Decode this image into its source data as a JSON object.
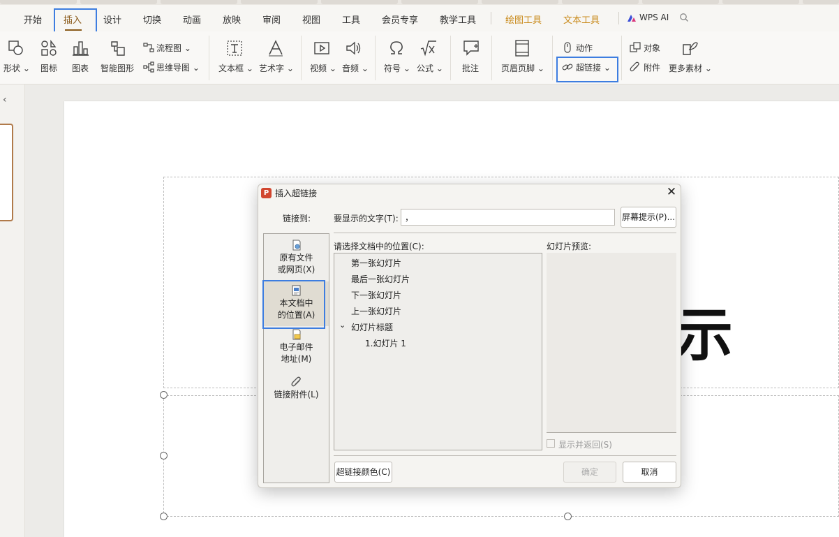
{
  "menu": {
    "tabs": [
      "开始",
      "插入",
      "设计",
      "切换",
      "动画",
      "放映",
      "审阅",
      "视图",
      "工具",
      "会员专享",
      "教学工具",
      "绘图工具",
      "文本工具"
    ],
    "active_tab": "插入",
    "wps_ai": "WPS AI"
  },
  "ribbon": {
    "shape": "形状",
    "icon": "图标",
    "chart": "图表",
    "smart_graphic": "智能图形",
    "flowchart": "流程图",
    "mindmap": "思维导图",
    "textbox": "文本框",
    "wordart": "艺术字",
    "video": "视频",
    "audio": "音频",
    "symbol": "符号",
    "formula": "公式",
    "comment": "批注",
    "header_footer": "页眉页脚",
    "action": "动作",
    "hyperlink": "超链接",
    "object": "对象",
    "attachment": "附件",
    "more_materials": "更多素材"
  },
  "slide": {
    "visible_text": "示"
  },
  "dialog": {
    "title": "插入超链接",
    "link_to_label": "链接到:",
    "display_text_label": "要显示的文字(T):",
    "display_text_value": "，",
    "screen_tip_button": "屏幕提示(P)...",
    "location_label": "请选择文档中的位置(C):",
    "preview_label": "幻灯片预览:",
    "side_items": [
      {
        "line1": "原有文件",
        "line2": "或网页(X)"
      },
      {
        "line1": "本文档中",
        "line2": "的位置(A)"
      },
      {
        "line1": "电子邮件",
        "line2": "地址(M)"
      },
      {
        "line1": "链接附件(L)",
        "line2": ""
      }
    ],
    "tree_items": [
      "第一张幻灯片",
      "最后一张幻灯片",
      "下一张幻灯片",
      "上一张幻灯片",
      "幻灯片标题",
      "1.幻灯片 1"
    ],
    "show_and_return": "显示并返回(S)",
    "hyperlink_color_button": "超链接颜色(C)",
    "ok_button": "确定",
    "cancel_button": "取消"
  }
}
